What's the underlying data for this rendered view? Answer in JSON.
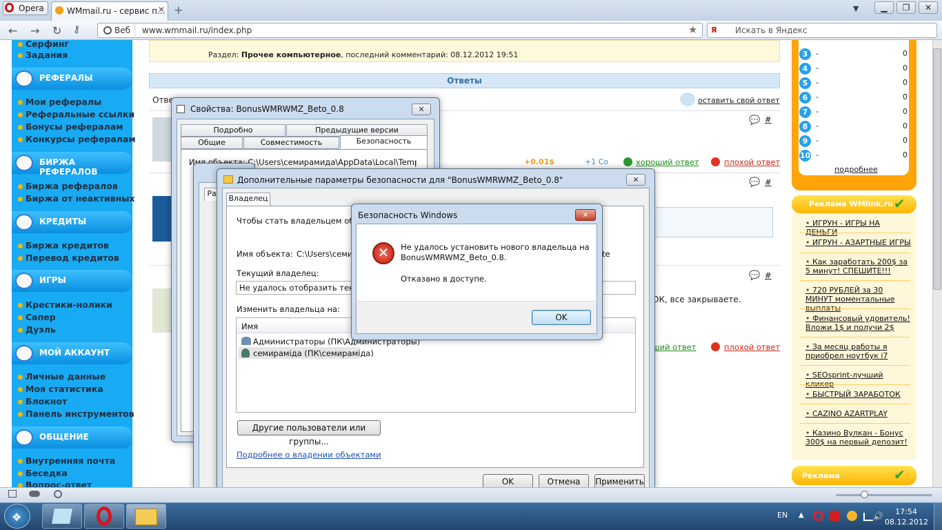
{
  "browser": {
    "menu_label": "Opera",
    "tab_title": "WMmail.ru - сервис п...",
    "web_label": "Веб",
    "url": "www.wmmail.ru/index.php",
    "search_placeholder": "Искать в Яндекс",
    "yandex_label": "Я"
  },
  "leftnav": {
    "top_items": [
      "Серфинг",
      "Задания"
    ],
    "sections": [
      {
        "title": "РЕФЕРАЛЫ",
        "items": [
          "Мои рефералы",
          "Реферальные ссылки",
          "Бонусы рефералам",
          "Конкурсы рефералам"
        ]
      },
      {
        "title": "БИРЖА РЕФЕРАЛОВ",
        "items": [
          "Биржа рефералов",
          "Биржа от неактивных"
        ]
      },
      {
        "title": "КРЕДИТЫ",
        "items": [
          "Биржа кредитов",
          "Перевод кредитов"
        ]
      },
      {
        "title": "ИГРЫ",
        "items": [
          "Крестики-нолики",
          "Сапер",
          "Дуэль"
        ]
      },
      {
        "title": "МОЙ АККАУНТ",
        "items": [
          "Личные данные",
          "Моя статистика",
          "Блокнот",
          "Панель инструментов"
        ]
      },
      {
        "title": "ОБЩЕНИЕ",
        "items": [
          "Внутренняя почта",
          "Беседка",
          "Вопрос-ответ"
        ]
      }
    ]
  },
  "content": {
    "section_label": "Раздел:",
    "section_name": "Прочее компьютерное",
    "last_comment": ", последний комментарий: 08.12.2012 19:51",
    "answers_header": "Ответы",
    "answers_prefix": "Отве",
    "leave_answer": "оставить свой ответ",
    "hash": "#",
    "good_answer": "хороший ответ",
    "bad_answer": "плохой ответ",
    "partial_good": "ший ответ",
    "rating_partial": "+0.01$",
    "count_partial": "+1 Со",
    "post_text_tail": "ОК, все закрываете."
  },
  "rightpanel": {
    "ranks": [
      {
        "n": "3",
        "v": "0"
      },
      {
        "n": "4",
        "v": "0"
      },
      {
        "n": "5",
        "v": "0"
      },
      {
        "n": "6",
        "v": "0"
      },
      {
        "n": "7",
        "v": "0"
      },
      {
        "n": "8",
        "v": "0"
      },
      {
        "n": "9",
        "v": "0"
      },
      {
        "n": "10",
        "v": "0"
      }
    ],
    "dash": "-",
    "more": "подробнее",
    "wmlink_title": "Реклама WMlink.ru",
    "wmlink_items": [
      "ИГРУН - ИГРЫ НА ДЕНЬГИ",
      "ИГРУН - АЗАРТНЫЕ ИГРЫ",
      "Как заработать 200$ за 5 минут! СПЕШИТЕ!!!",
      "720 РУБЛЕЙ за 30 МИНУТ моментальные выплаты",
      "Финансовый удовитель! Вложи 1$ и получи 2$",
      "За месяц работы я приобрел ноутбук i7",
      "SEOsprint-лучший кликер",
      "БЫСТРЫЙ ЗАРАБОТОК",
      "CAZINO AZARTPLAY",
      "Казино Вулкан - Бонус 300$ на первый депозит!"
    ],
    "ad_title": "Реклама"
  },
  "props_dialog": {
    "title": "Свойства: BonusWMRWMZ_Beto_0.8",
    "tabs_row1": [
      "Подробно",
      "Предыдущие версии"
    ],
    "tabs_row2": [
      "Общие",
      "Совместимость",
      "Безопасность"
    ],
    "obj_partial": "Имя объекта:   C:\\Users\\семирамида\\AppData\\Local\\Temp\\B"
  },
  "adv_dialog": {
    "title": "Дополнительные параметры безопасности  для \"BonusWMRWMZ_Beto_0.8\"",
    "tab": "Владелец",
    "intro": "Чтобы стать владельцем объект",
    "obj_label": "Имя объекта:",
    "obj_value": "C:\\Users\\семир",
    "obj_tail": "te",
    "cur_owner_label": "Текущий владелец:",
    "cur_owner_value": "Не удалось отобразить текущег",
    "change_label": "Изменить владельца на:",
    "col_name": "Имя",
    "users": [
      "Администраторы (ПК\\Администраторы)",
      "семираміда (ПК\\семираміда)"
    ],
    "other_users_btn": "Другие пользователи или группы...",
    "more_link": "Подробнее о владении объектами",
    "ok": "OK",
    "cancel": "Отмена",
    "apply": "Применить",
    "bg_tab": "Ра"
  },
  "error_dialog": {
    "title": "Безопасность Windows",
    "line1": "Не удалось установить нового владельца на",
    "line2": "BonusWMRWMZ_Beto_0.8.",
    "line3": "Отказано в доступе.",
    "ok": "OK"
  },
  "taskbar": {
    "lang": "EN",
    "time": "17:54",
    "date": "08.12.2012"
  }
}
